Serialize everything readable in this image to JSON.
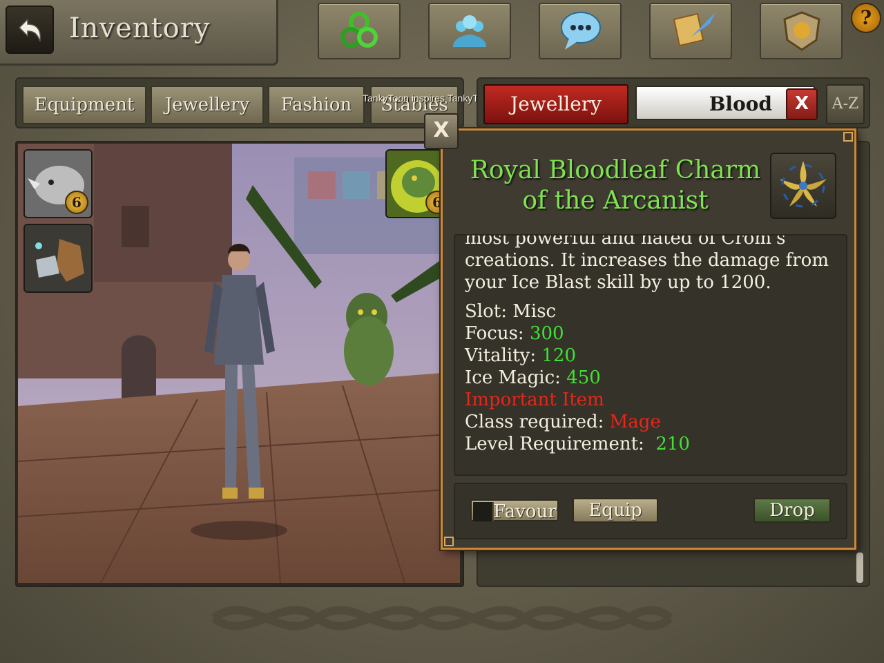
{
  "header": {
    "title": "Inventory",
    "icons": [
      {
        "name": "skills-icon"
      },
      {
        "name": "social-icon"
      },
      {
        "name": "chat-icon"
      },
      {
        "name": "quests-icon"
      },
      {
        "name": "guild-icon"
      }
    ],
    "help_label": "?"
  },
  "tabs": [
    "Equipment",
    "Jewellery",
    "Fashion",
    "Stables"
  ],
  "notice": "TankyToon inspires TankyToon",
  "filter": {
    "category": "Jewellery",
    "search_value": "Blood",
    "clear_label": "X",
    "sort_label": "A-Z"
  },
  "slots": [
    {
      "name": "mount-slot",
      "level": "6"
    },
    {
      "name": "gloves-slot"
    },
    {
      "name": "pet-slot",
      "level": "6"
    }
  ],
  "popup": {
    "close_label": "X",
    "item_name": "Royal Bloodleaf Charm of the Arcanist",
    "description": "most powerful and hated of Crom's creations. It increases the damage from your Ice Blast skill by up to 1200.",
    "stats": {
      "slot": "Slot: Misc",
      "focus_label": "Focus: ",
      "focus_value": "300",
      "vitality_label": "Vitality: ",
      "vitality_value": "120",
      "ice_label": "Ice Magic: ",
      "ice_value": "450",
      "important": "Important Item",
      "class_label": "Class required: ",
      "class_value": "Mage",
      "level_label": "Level Requirement:  ",
      "level_value": "210"
    },
    "actions": {
      "favour": "Favour",
      "equip": "Equip",
      "drop": "Drop"
    }
  }
}
